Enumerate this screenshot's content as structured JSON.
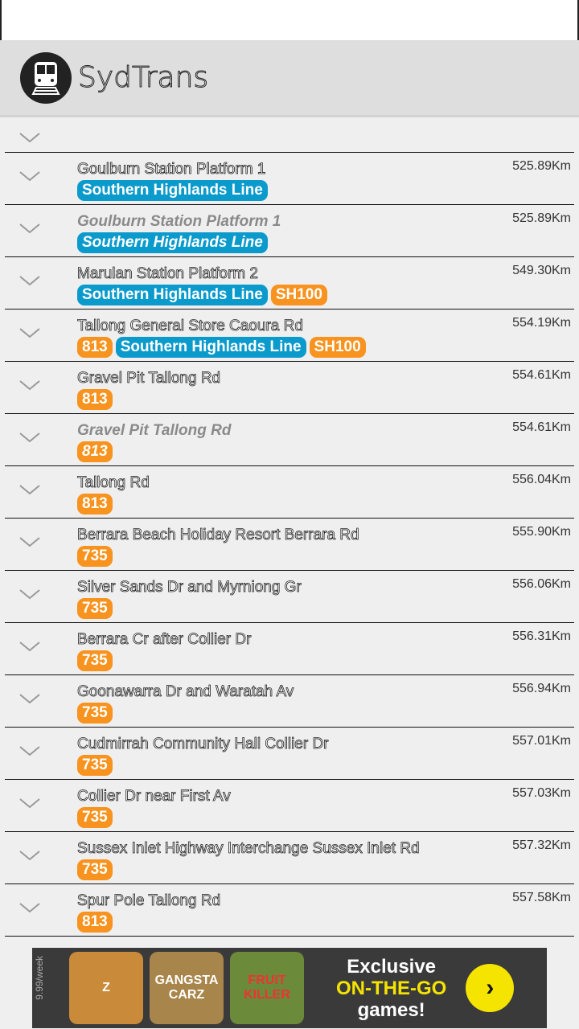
{
  "app": {
    "title": "SydTrans",
    "logo_icon": "train-icon"
  },
  "colors": {
    "line_badge": "#0a9acc",
    "bus_badge": "#f7931e",
    "actionbar": "#dedede"
  },
  "stops": [
    {
      "name": "Goulburn Station Platform 1",
      "distance": "525.89Km",
      "routes": [
        {
          "label": "Southern Highlands Line",
          "type": "blue"
        }
      ],
      "disabled": false
    },
    {
      "name": "Goulburn Station Platform 1",
      "distance": "525.89Km",
      "routes": [
        {
          "label": "Southern Highlands Line",
          "type": "blue"
        }
      ],
      "disabled": true
    },
    {
      "name": "Marulan Station Platform 2",
      "distance": "549.30Km",
      "routes": [
        {
          "label": "Southern Highlands Line",
          "type": "blue"
        },
        {
          "label": "SH100",
          "type": "orange"
        }
      ],
      "disabled": false
    },
    {
      "name": "Tallong General Store  Caoura Rd",
      "distance": "554.19Km",
      "routes": [
        {
          "label": "813",
          "type": "orange"
        },
        {
          "label": "Southern Highlands Line",
          "type": "blue"
        },
        {
          "label": "SH100",
          "type": "orange"
        }
      ],
      "disabled": false
    },
    {
      "name": "Gravel Pit Tallong Rd",
      "distance": "554.61Km",
      "routes": [
        {
          "label": "813",
          "type": "orange"
        }
      ],
      "disabled": false
    },
    {
      "name": "Gravel Pit Tallong Rd",
      "distance": "554.61Km",
      "routes": [
        {
          "label": "813",
          "type": "orange"
        }
      ],
      "disabled": true
    },
    {
      "name": "Tallong Rd",
      "distance": "556.04Km",
      "routes": [
        {
          "label": "813",
          "type": "orange"
        }
      ],
      "disabled": false
    },
    {
      "name": "Berrara Beach Holiday Resort Berrara Rd",
      "distance": "555.90Km",
      "routes": [
        {
          "label": "735",
          "type": "orange"
        }
      ],
      "disabled": false
    },
    {
      "name": "Silver Sands Dr and Myrniong Gr",
      "distance": "556.06Km",
      "routes": [
        {
          "label": "735",
          "type": "orange"
        }
      ],
      "disabled": false
    },
    {
      "name": "Berrara Cr after Collier Dr",
      "distance": "556.31Km",
      "routes": [
        {
          "label": "735",
          "type": "orange"
        }
      ],
      "disabled": false
    },
    {
      "name": "Goonawarra Dr and Waratah Av",
      "distance": "556.94Km",
      "routes": [
        {
          "label": "735",
          "type": "orange"
        }
      ],
      "disabled": false
    },
    {
      "name": "Cudmirrah Community Hall Collier Dr",
      "distance": "557.01Km",
      "routes": [
        {
          "label": "735",
          "type": "orange"
        }
      ],
      "disabled": false
    },
    {
      "name": "Collier Dr near First Av",
      "distance": "557.03Km",
      "routes": [
        {
          "label": "735",
          "type": "orange"
        }
      ],
      "disabled": false
    },
    {
      "name": "Sussex Inlet Highway Interchange Sussex Inlet Rd",
      "distance": "557.32Km",
      "routes": [
        {
          "label": "735",
          "type": "orange"
        }
      ],
      "disabled": false
    },
    {
      "name": "Spur Pole Tallong Rd",
      "distance": "557.58Km",
      "routes": [
        {
          "label": "813",
          "type": "orange"
        }
      ],
      "disabled": false
    }
  ],
  "ad": {
    "price": "9.99/week",
    "tiles": [
      "Z",
      "GANGSTA CARZ",
      "FRUIT KILLER"
    ],
    "line1": "Exclusive",
    "line2": "ON-THE-GO",
    "line3": "games!",
    "button_icon": "chevron-right-icon"
  }
}
